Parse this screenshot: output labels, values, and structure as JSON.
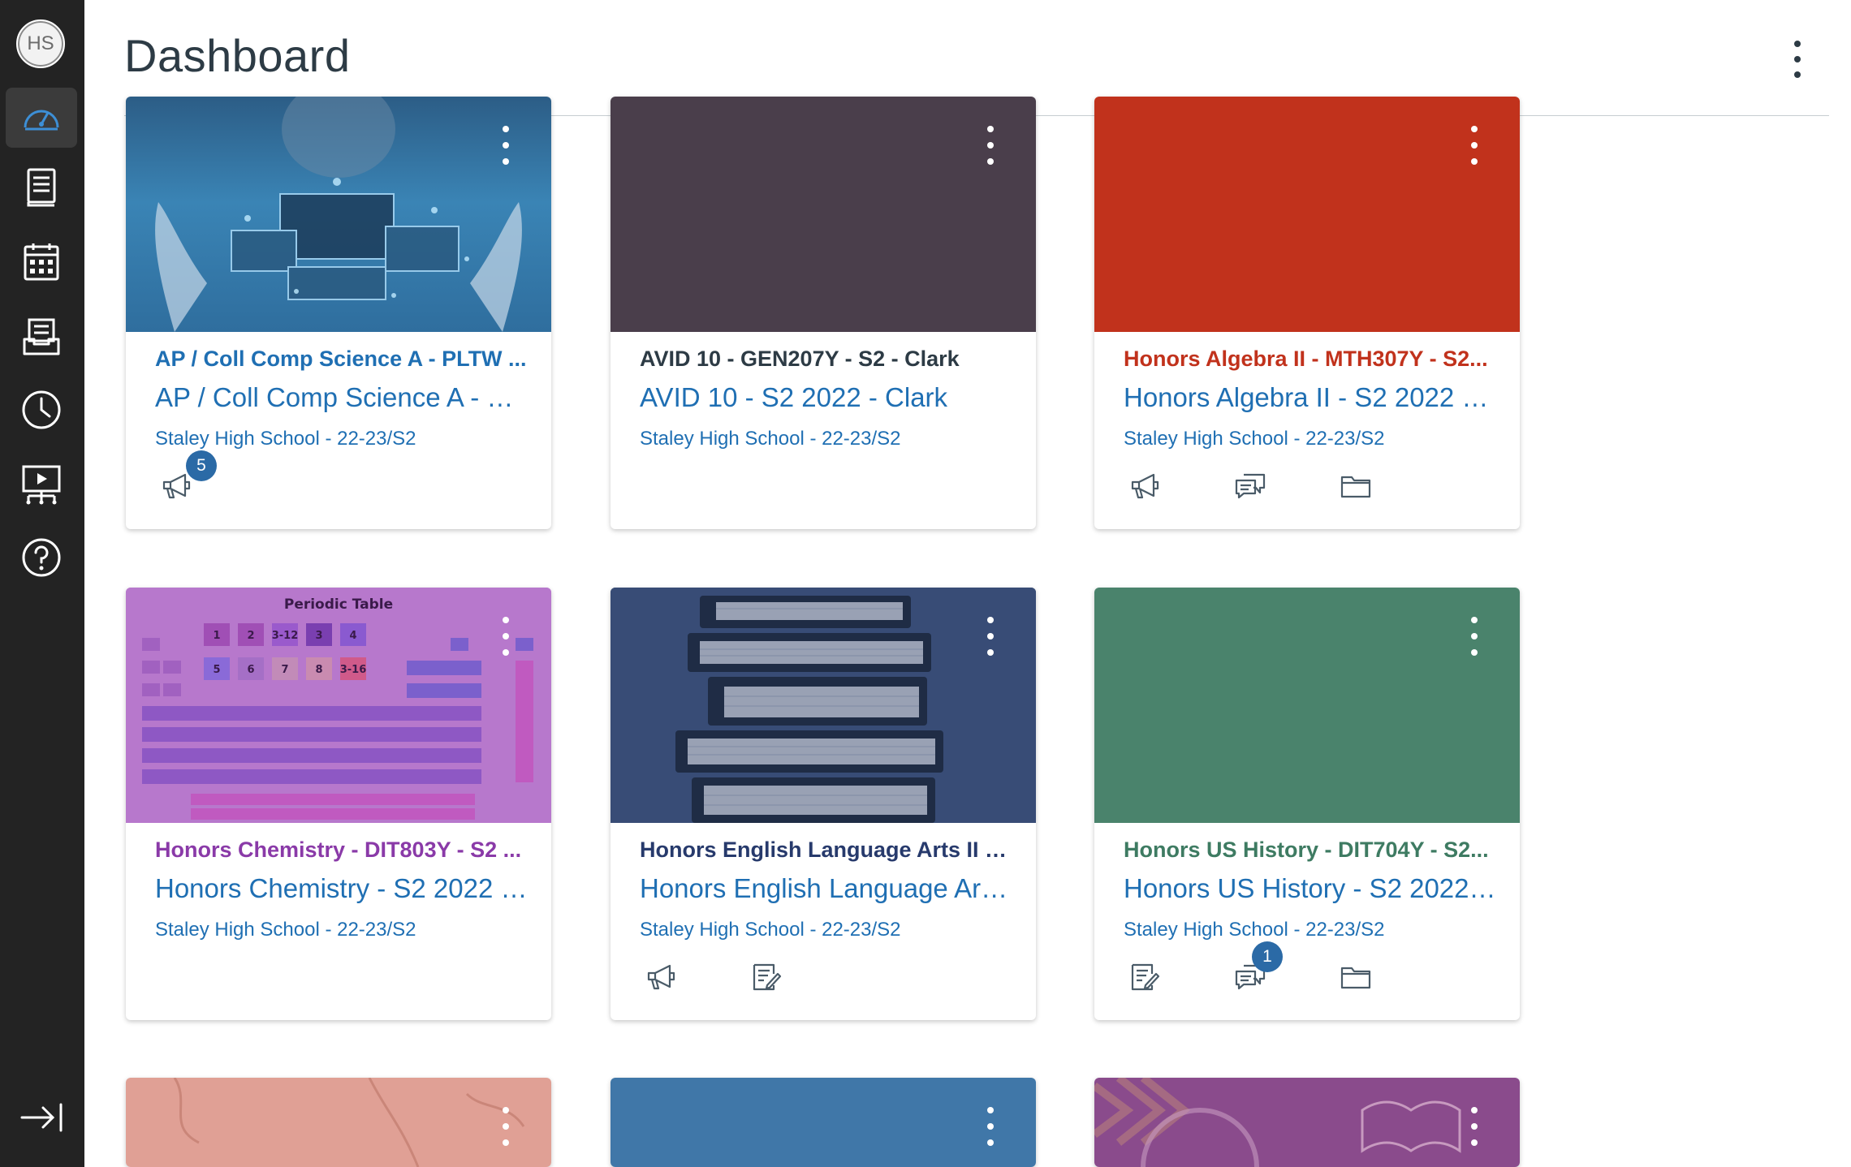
{
  "user": {
    "initials": "HS"
  },
  "header": {
    "title": "Dashboard"
  },
  "nav": [
    {
      "name": "dashboard",
      "active": true
    },
    {
      "name": "courses"
    },
    {
      "name": "calendar"
    },
    {
      "name": "inbox"
    },
    {
      "name": "history"
    },
    {
      "name": "studio"
    },
    {
      "name": "help"
    }
  ],
  "cards": [
    {
      "code": "AP / Coll Comp Science A - PLTW ...",
      "name": "AP / Coll Comp Science A - PL...",
      "term": "Staley High School - 22-23/S2",
      "code_color": "#1f6fb3",
      "hero": "technology-image",
      "badge_announcements": "5"
    },
    {
      "code": "AVID 10 - GEN207Y - S2 - Clark",
      "name": "AVID 10 - S2 2022 - Clark",
      "term": "Staley High School - 22-23/S2",
      "code_color": "#2d3b45",
      "hero_color": "#4a3e4b"
    },
    {
      "code": "Honors Algebra II - MTH307Y - S2...",
      "name": "Honors Algebra II - S2 2022 - ...",
      "term": "Staley High School - 22-23/S2",
      "code_color": "#c1321c",
      "hero_color": "#c1321c"
    },
    {
      "code": "Honors Chemistry - DIT803Y - S2 ...",
      "name": "Honors Chemistry - S2 2022 -...",
      "term": "Staley High School - 22-23/S2",
      "code_color": "#8a3aa8",
      "hero": "periodic-table-image",
      "periodic_title": "Periodic Table",
      "periodic_keys": [
        "1",
        "2",
        "3-12",
        "3",
        "4",
        "5",
        "6",
        "7",
        "8",
        "3-16"
      ]
    },
    {
      "code": "Honors English Language Arts II - ...",
      "name": "Honors English Language Arts ...",
      "term": "Staley High School - 22-23/S2",
      "code_color": "#273a6c",
      "hero": "books-image"
    },
    {
      "code": "Honors US History - DIT704Y - S2...",
      "name": "Honors US History - S2 2022 ...",
      "term": "Staley High School - 22-23/S2",
      "code_color": "#3e7b62",
      "hero_color": "#4a836c",
      "badge_discussions": "1"
    },
    {
      "hero_color": "#e0a095",
      "hero": "map-image"
    },
    {
      "hero_color": "#4077a8"
    },
    {
      "hero_color": "#8a4b8c",
      "hero": "staley-image"
    }
  ]
}
